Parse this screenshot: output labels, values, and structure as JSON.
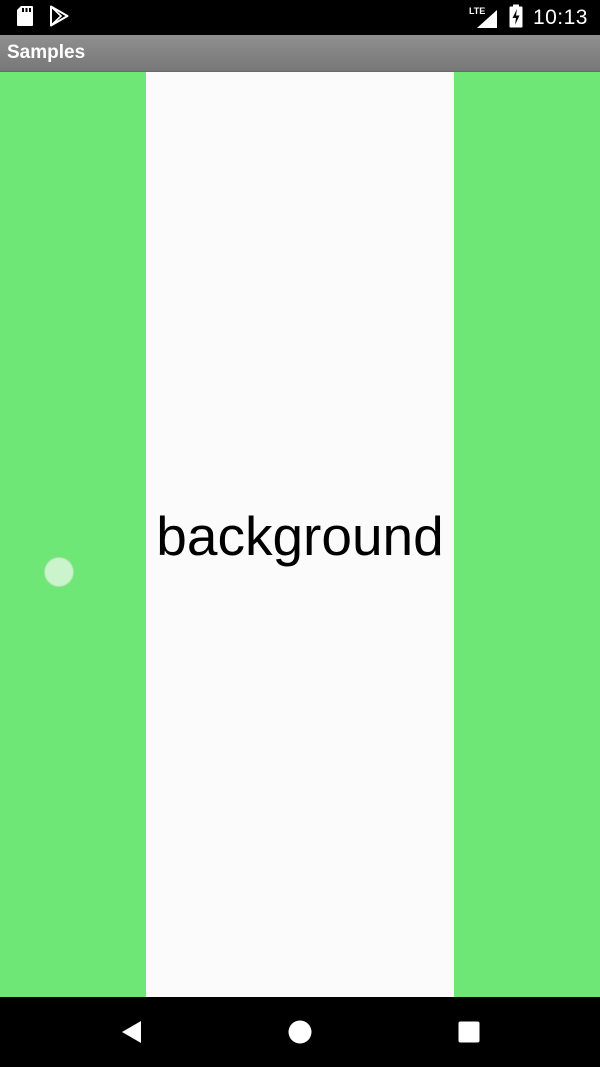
{
  "status_bar": {
    "time": "10:13",
    "network_label": "LTE",
    "icons": [
      "sd-card-icon",
      "play-store-icon",
      "signal-icon",
      "battery-charging-icon"
    ]
  },
  "app_bar": {
    "title": "Samples"
  },
  "main": {
    "center_label": "background",
    "colors": {
      "side_background": "#6ee776",
      "center_background": "#fcfbfc",
      "text": "#000000"
    }
  },
  "nav_bar": {
    "buttons": [
      "back-icon",
      "home-icon",
      "recents-icon"
    ]
  }
}
